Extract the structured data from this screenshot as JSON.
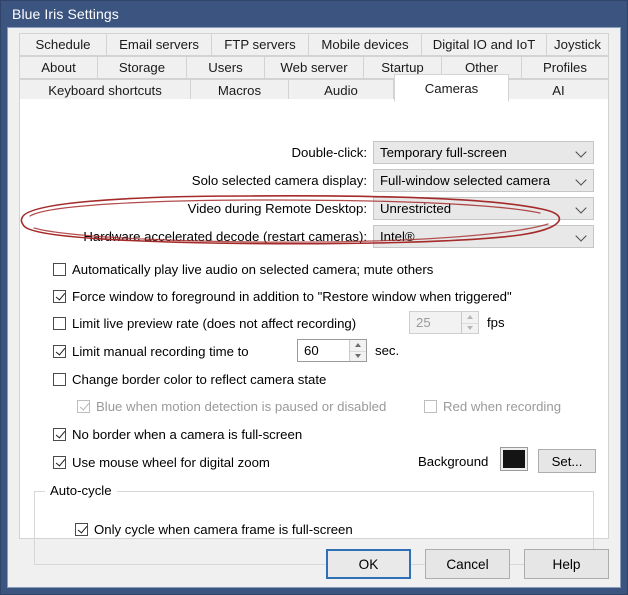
{
  "window": {
    "title": "Blue Iris Settings",
    "titlebar_color": "#3b5480"
  },
  "tabs": {
    "row1": [
      {
        "label": "Schedule",
        "selected": false
      },
      {
        "label": "Email servers",
        "selected": false
      },
      {
        "label": "FTP servers",
        "selected": false
      },
      {
        "label": "Mobile devices",
        "selected": false
      },
      {
        "label": "Digital IO and IoT",
        "selected": false
      },
      {
        "label": "Joystick",
        "selected": false
      }
    ],
    "row2": [
      {
        "label": "About",
        "selected": false
      },
      {
        "label": "Storage",
        "selected": false
      },
      {
        "label": "Users",
        "selected": false
      },
      {
        "label": "Web server",
        "selected": false
      },
      {
        "label": "Startup",
        "selected": false
      },
      {
        "label": "Other",
        "selected": false
      },
      {
        "label": "Profiles",
        "selected": false
      }
    ],
    "row3": [
      {
        "label": "Keyboard shortcuts",
        "selected": false
      },
      {
        "label": "Macros",
        "selected": false
      },
      {
        "label": "Audio",
        "selected": false
      },
      {
        "label": "Cameras",
        "selected": true
      },
      {
        "label": "AI",
        "selected": false
      }
    ]
  },
  "dropdowns": [
    {
      "label": "Double-click:",
      "value": "Temporary full-screen"
    },
    {
      "label": "Solo selected camera display:",
      "value": "Full-window selected camera"
    },
    {
      "label": "Video during Remote Desktop:",
      "value": "Unrestricted"
    },
    {
      "label": "Hardware accelerated decode (restart cameras):",
      "value": "Intel®"
    }
  ],
  "checkboxes": {
    "auto_audio": {
      "label": "Automatically play live audio on selected camera; mute others",
      "checked": false,
      "enabled": true
    },
    "force_foreground": {
      "label": "Force window to foreground in addition to \"Restore window when triggered\"",
      "checked": true,
      "enabled": true
    },
    "limit_preview": {
      "label": "Limit live preview rate (does not affect recording)",
      "checked": false,
      "enabled": true
    },
    "limit_manual": {
      "label": "Limit manual recording time to",
      "checked": true,
      "enabled": true
    },
    "change_border": {
      "label": "Change border color to reflect camera state",
      "checked": false,
      "enabled": true
    },
    "blue_when_paused": {
      "label": "Blue when motion detection is paused or disabled",
      "checked": true,
      "enabled": false
    },
    "red_when_recording": {
      "label": "Red when recording",
      "checked": false,
      "enabled": false
    },
    "no_border_fullscreen": {
      "label": "No border when a camera is full-screen",
      "checked": true,
      "enabled": true
    },
    "mouse_wheel_zoom": {
      "label": "Use mouse wheel for digital zoom",
      "checked": true,
      "enabled": true
    },
    "only_cycle_fullscreen": {
      "label": "Only cycle when camera frame is full-screen",
      "checked": true,
      "enabled": true
    }
  },
  "spinners": {
    "fps": {
      "value": "25",
      "unit": "fps",
      "enabled": false
    },
    "seconds": {
      "value": "60",
      "unit": "sec.",
      "enabled": true
    }
  },
  "background": {
    "label": "Background",
    "color": "#141414",
    "set_button": "Set..."
  },
  "groups": {
    "auto_cycle_title": "Auto-cycle"
  },
  "buttons": {
    "ok": "OK",
    "cancel": "Cancel",
    "help": "Help"
  },
  "annotation": {
    "color": "#a52a2a",
    "shape": "hand-drawn-ellipse"
  }
}
